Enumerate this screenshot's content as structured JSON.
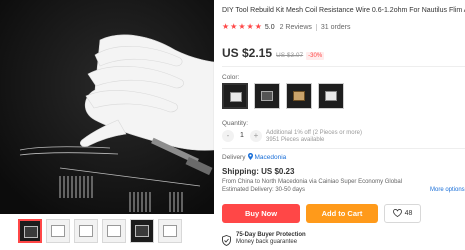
{
  "product": {
    "title": "DIY Tool Rebuild Kit Mesh Coil Resistance Wire 0.6-1.2ohm For Nautilus Flim AVP",
    "rating": "5.0",
    "reviews": "2 Reviews",
    "orders": "31 orders",
    "price": "US $2.15",
    "old_price": "US $3.07",
    "discount": "-30%"
  },
  "color": {
    "label": "Color:",
    "options": [
      "coil-plates-white",
      "coil-plates-black",
      "wire-spool-tin",
      "coil-plates-dark"
    ]
  },
  "quantity": {
    "label": "Quantity:",
    "minus": "-",
    "value": "1",
    "plus": "+",
    "note_line1": "Additional 1% off (2 Pieces or more)",
    "note_line2": "3951 Pieces available"
  },
  "delivery": {
    "label": "Delivery",
    "country": "Macedonia"
  },
  "shipping": {
    "title": "Shipping: US $0.23",
    "route": "From China to North Macedonia via Cainiao Super Economy Global",
    "estimate": "Estimated Delivery: 30-50 days",
    "more_options": "More options"
  },
  "actions": {
    "buy_now": "Buy Now",
    "add_to_cart": "Add to Cart",
    "wishlist_count": "48"
  },
  "protection": {
    "title": "75-Day Buyer Protection",
    "subtitle": "Money back guarantee"
  },
  "colors": {
    "accent_red": "#ff4747",
    "accent_orange": "#ff9a1a",
    "link_blue": "#1a6fd8"
  }
}
